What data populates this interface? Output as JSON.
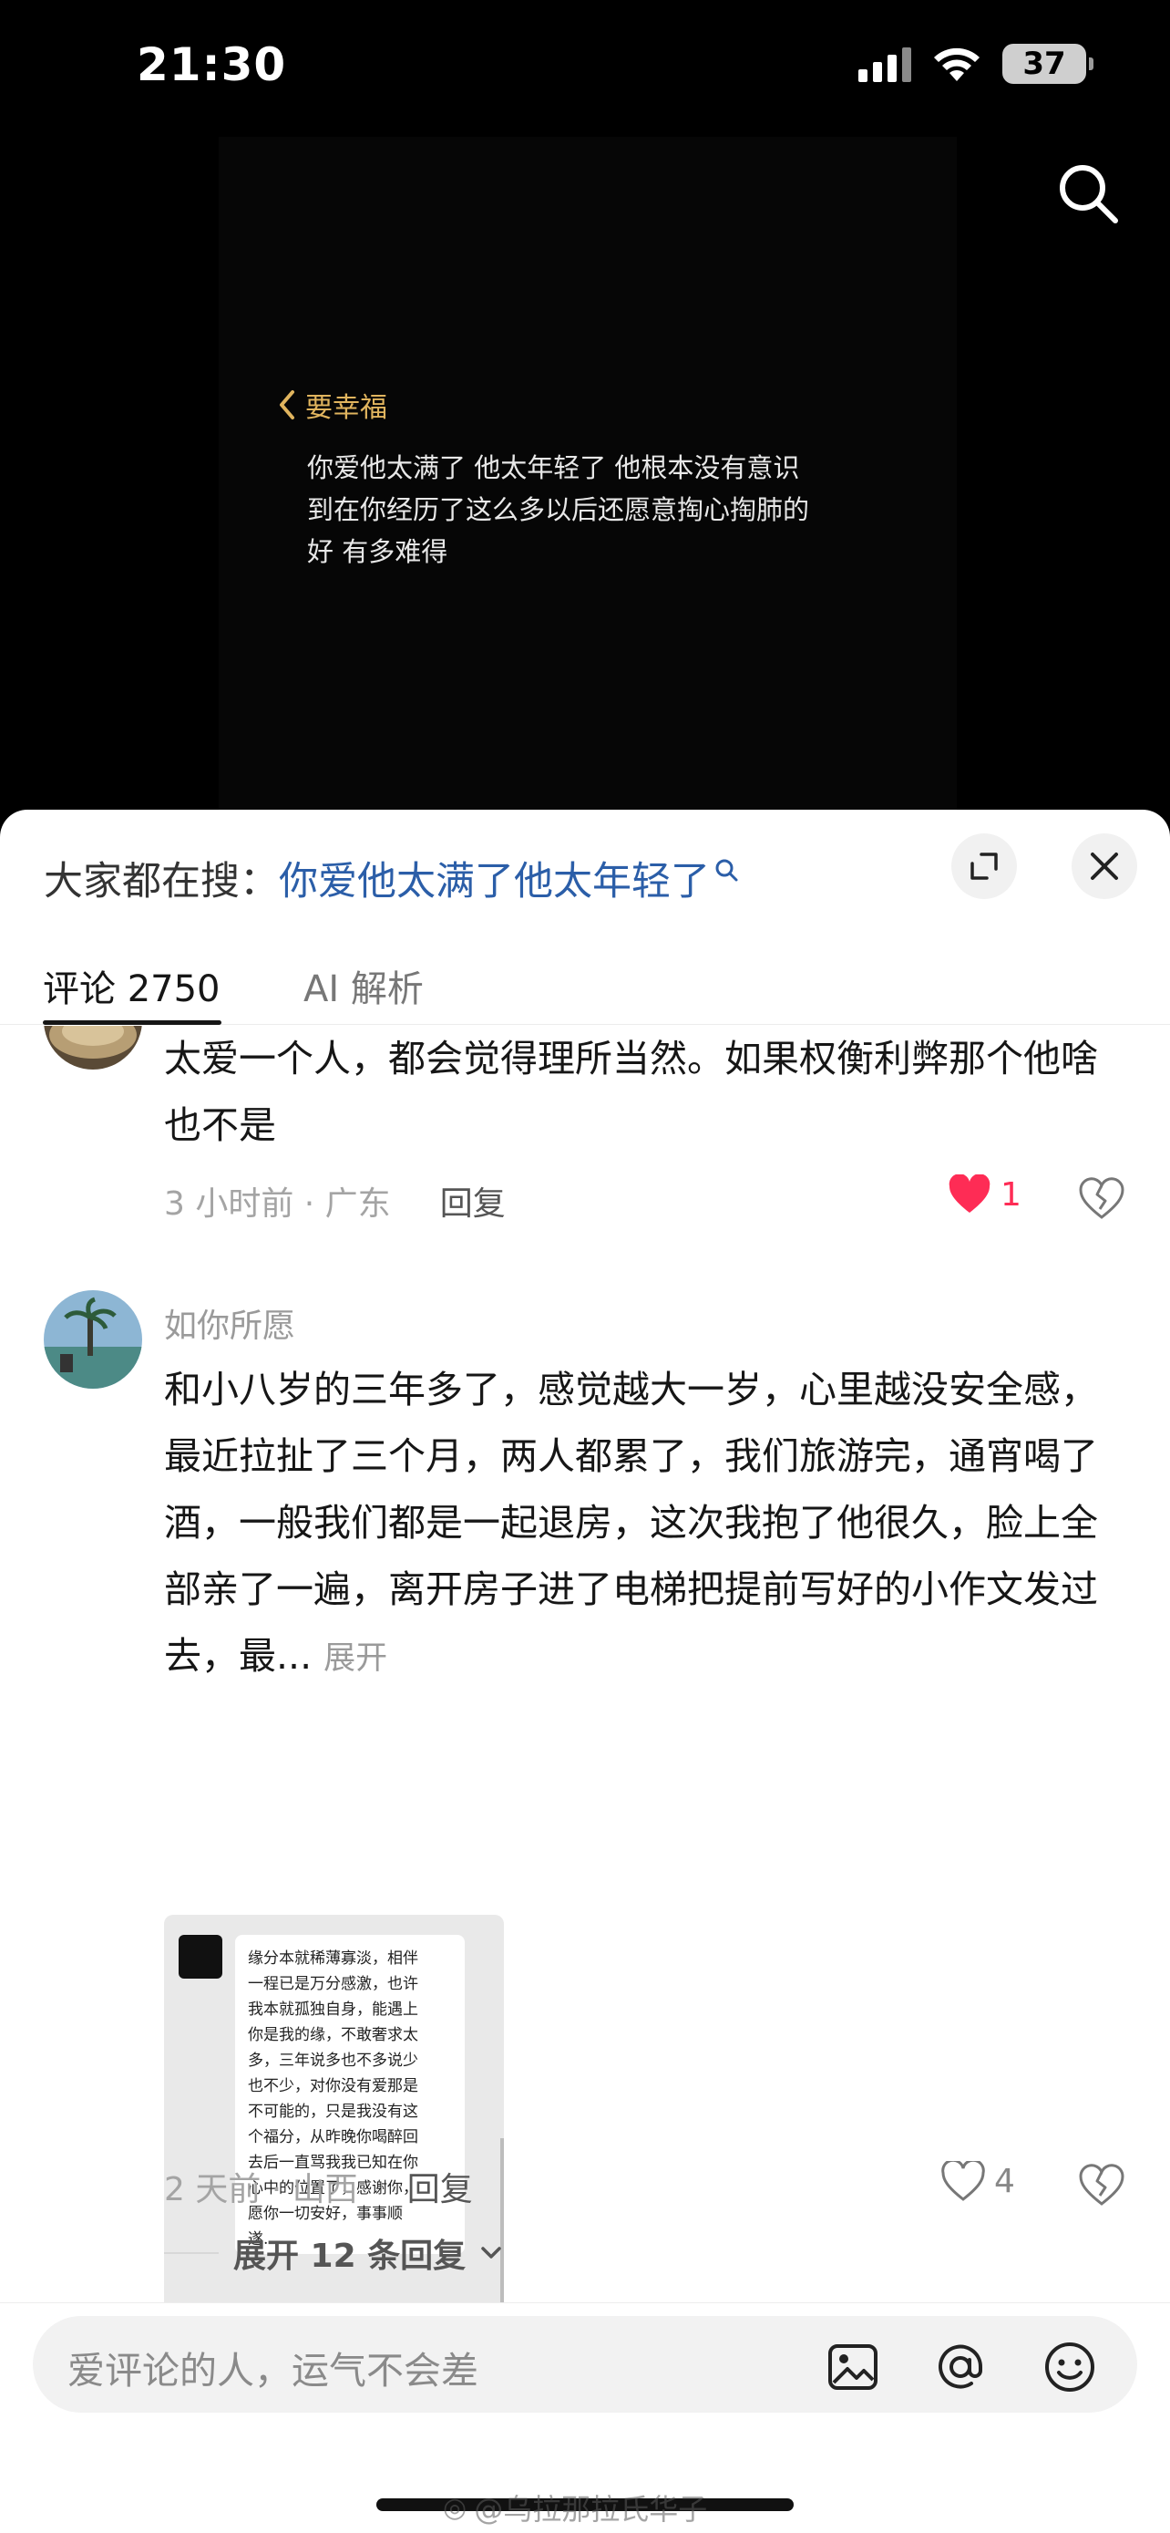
{
  "status_bar": {
    "time": "21:30",
    "battery": "37"
  },
  "video": {
    "back_label": "要幸福",
    "caption": "你爱他太满了 他太年轻了 他根本没有意识\n到在你经历了这么多以后还愿意掏心掏肺的\n好 有多难得"
  },
  "sheet": {
    "search_prefix": "大家都在搜：",
    "search_query": "你爱他太满了他太年轻了",
    "tabs": {
      "comments": "评论 2750",
      "ai": "AI 解析"
    }
  },
  "comments": [
    {
      "text": "太爱一个人，都会觉得理所当然。如果权衡利弊那个他啥也不是",
      "time_location": "3 小时前 · 广东",
      "reply_label": "回复",
      "likes": "1",
      "liked": true
    },
    {
      "author": "如你所愿",
      "text": "和小八岁的三年多了，感觉越大一岁，心里越没安全感，最近拉扯了三个月，两人都累了，我们旅游完，通宵喝了酒，一般我们都是一起退房，这次我抱了他很久，脸上全部亲了一遍，离开房子进了电梯把提前写好的小作文发过去，最...",
      "expand_label": "展开",
      "attachment_text": "缘分本就稀薄寡淡，相伴\n一程已是万分感激，也许\n我本就孤独自身，能遇上\n你是我的缘，不敢奢求太\n多，三年说多也不多说少\n也不少，对你没有爱那是\n不可能的，只是我没有这\n个福分，从昨晚你喝醉回\n去后一直骂我我已知在你\n心中的位置了，感谢你，\n愿你一切安好，事事顺\n遂...",
      "time_location": "2 天前 · 山西",
      "reply_label": "回复",
      "likes": "4",
      "liked": false,
      "more_replies": "展开 12 条回复"
    }
  ],
  "input": {
    "placeholder": "爱评论的人，运气不会差"
  },
  "watermark": "@乌拉那拉氏华子",
  "colors": {
    "like_red": "#fe2c55",
    "query_blue": "#2b5ea8",
    "back_gold": "#e0b45e"
  }
}
